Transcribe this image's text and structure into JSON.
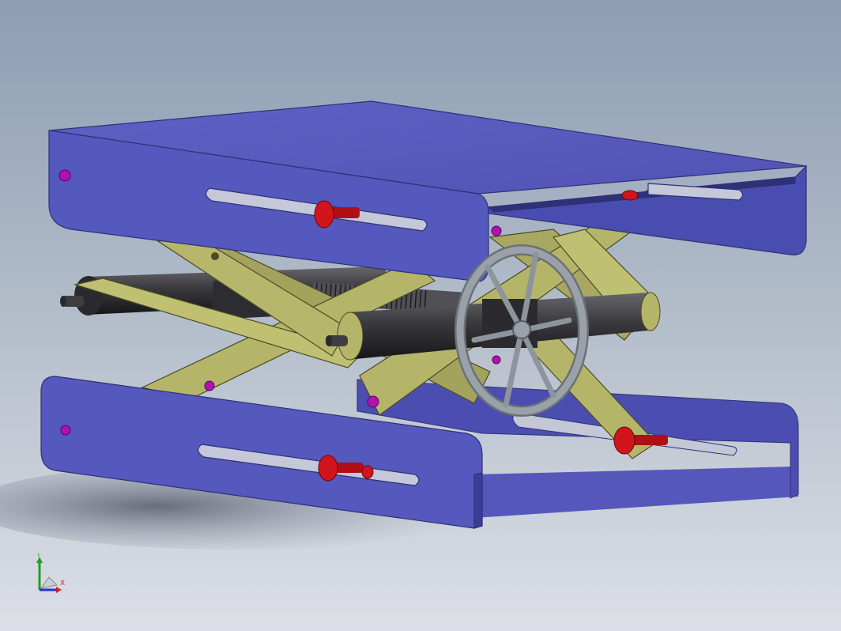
{
  "colors": {
    "plate_face": "#5c5fc0",
    "plate_edge": "#4144a0",
    "plate_dark": "#2f3178",
    "arm": "#b5b56a",
    "arm_dark": "#8e8e4c",
    "arm_edge": "#4b4b25",
    "roller": "#3a3a3e",
    "pin_red": "#cc1018",
    "pin_magenta": "#b012b0",
    "wheel": "#8d949c",
    "background_top": "#8d9db3",
    "background_bottom": "#dcdfe6",
    "shadow": "#6e7383"
  },
  "model": {
    "parts": [
      "top-plate",
      "bottom-plate",
      "scissor-arms",
      "lead-screw",
      "rollers",
      "handwheel",
      "pins"
    ]
  },
  "triad": {
    "y_label": "Y",
    "x_label": "X",
    "z_label": "",
    "icons": [
      "y-axis-arrow-icon",
      "x-axis-arrow-icon",
      "z-axis-arrow-icon"
    ]
  }
}
